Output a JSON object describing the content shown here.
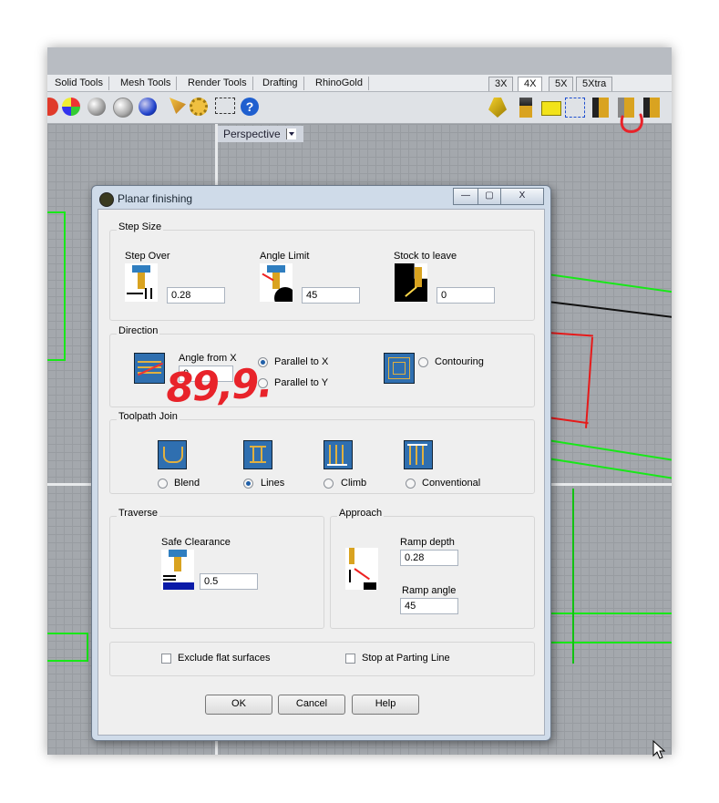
{
  "ribbon": {
    "tabs": [
      "Solid Tools",
      "Mesh Tools",
      "Render Tools",
      "Drafting",
      "RhinoGold"
    ],
    "right_tabs": [
      "3X",
      "4X",
      "5X",
      "5Xtra"
    ],
    "active_right_tab": "4X"
  },
  "viewport": {
    "label": "Perspective"
  },
  "dialog": {
    "title": "Planar finishing",
    "window_buttons": {
      "minimize": "—",
      "maximize": "▢",
      "close": "X"
    },
    "step_size": {
      "title": "Step Size",
      "step_over_label": "Step Over",
      "step_over_value": "0.28",
      "angle_limit_label": "Angle Limit",
      "angle_limit_value": "45",
      "stock_label": "Stock to leave",
      "stock_value": "0"
    },
    "direction": {
      "title": "Direction",
      "angle_label": "Angle from X",
      "angle_value": "0",
      "parallel_x": "Parallel to X",
      "parallel_y": "Parallel to Y",
      "contouring": "Contouring",
      "selected": "Parallel to X",
      "annotation": "89,9."
    },
    "toolpath_join": {
      "title": "Toolpath Join",
      "options": [
        "Blend",
        "Lines",
        "Climb",
        "Conventional"
      ],
      "selected": "Lines"
    },
    "traverse": {
      "title": "Traverse",
      "safe_label": "Safe Clearance",
      "safe_value": "0.5"
    },
    "approach": {
      "title": "Approach",
      "ramp_depth_label": "Ramp depth",
      "ramp_depth_value": "0.28",
      "ramp_angle_label": "Ramp angle",
      "ramp_angle_value": "45"
    },
    "options": {
      "exclude_flat": "Exclude flat surfaces",
      "stop_parting": "Stop at Parting Line"
    },
    "buttons": {
      "ok": "OK",
      "cancel": "Cancel",
      "help": "Help"
    }
  },
  "colors": {
    "grid_bg": "#a4a8ad",
    "curve_green": "#18e818",
    "curve_red": "#e61a1a",
    "annotation_red": "#e8232a"
  }
}
